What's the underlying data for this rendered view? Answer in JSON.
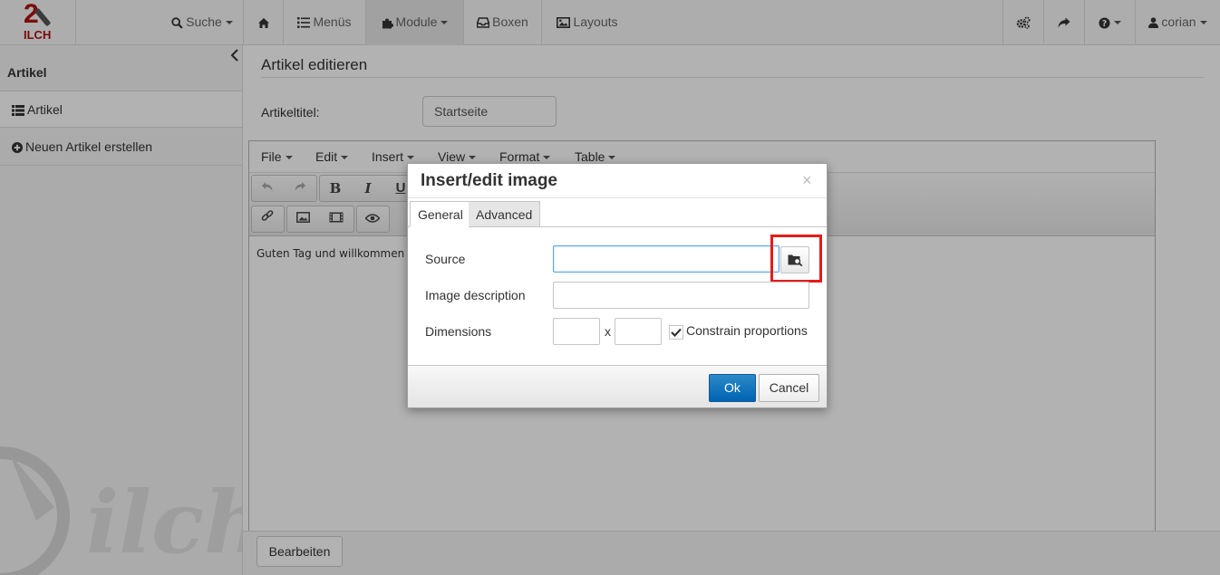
{
  "logo": {
    "number": "2",
    "word": "ILCH"
  },
  "navbar": {
    "search_label": "Suche",
    "menus_label": "Menüs",
    "modules_label": "Module",
    "boxes_label": "Boxen",
    "layouts_label": "Layouts",
    "user_label": "corian"
  },
  "sidebar": {
    "title": "Artikel",
    "items": [
      {
        "label": "Artikel",
        "icon": "list-icon",
        "active": true
      },
      {
        "label": "Neuen Artikel erstellen",
        "icon": "plus-circle-icon",
        "active": false
      }
    ],
    "watermark": "ilch"
  },
  "main": {
    "page_title": "Artikel editieren",
    "article_title_label": "Artikeltitel:",
    "article_title_value": "Startseite",
    "submit_label": "Bearbeiten"
  },
  "editor": {
    "menu": [
      "File",
      "Edit",
      "Insert",
      "View",
      "Format",
      "Table"
    ],
    "content_text": "Guten Tag und willkommen a"
  },
  "dialog": {
    "title": "Insert/edit image",
    "close": "×",
    "tabs": [
      "General",
      "Advanced"
    ],
    "active_tab": "General",
    "source_label": "Source",
    "source_value": "",
    "description_label": "Image description",
    "description_value": "",
    "dimensions_label": "Dimensions",
    "width_value": "",
    "height_value": "",
    "dimensions_separator": "x",
    "constrain_label": "Constrain proportions",
    "constrain_checked": true,
    "ok_label": "Ok",
    "cancel_label": "Cancel"
  },
  "colors": {
    "highlight": "#e51b1b",
    "primary_button": "#0063b3",
    "brand": "#b01010"
  }
}
